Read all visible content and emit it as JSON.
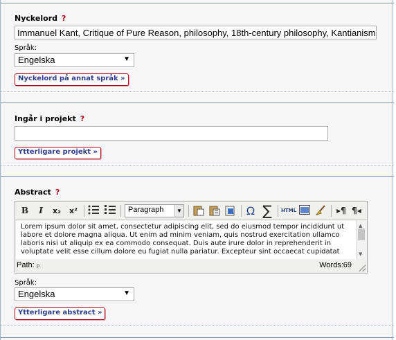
{
  "keywords": {
    "label": "Nyckelord",
    "required_mark": "?",
    "value": "Immanuel Kant, Critique of Pure Reason, philosophy, 18th-century philosophy, Kantianism",
    "lang_label": "Språk:",
    "lang_value": "Engelska",
    "more_button": "Nyckelord på annat språk »"
  },
  "project": {
    "label": "Ingår i projekt",
    "required_mark": "?",
    "value": "",
    "more_button": "Ytterligare projekt »"
  },
  "abstract": {
    "label": "Abstract",
    "required_mark": "?",
    "toolbar": {
      "bold": "B",
      "italic": "I",
      "subscript": "x₂",
      "superscript": "x²",
      "format_value": "Paragraph",
      "omega": "Ω",
      "sigma": "∑",
      "html": "HTML"
    },
    "text": "Lorem ipsum dolor sit amet, consectetur adipiscing elit, sed do eiusmod tempor incididunt ut labore et dolore magna aliqua. Ut enim ad minim veniam, quis nostrud exercitation ullamco laboris nisi ut aliquip ex ea commodo consequat. Duis aute irure dolor in reprehenderit in voluptate velit esse cillum dolore eu fugiat nulla pariatur. Excepteur sint occaecat cupidatat",
    "path_label": "Path:",
    "path_value": "p",
    "word_count": "Words:69",
    "lang_label": "Språk:",
    "lang_value": "Engelska",
    "more_button": "Ytterligare abstract »"
  }
}
